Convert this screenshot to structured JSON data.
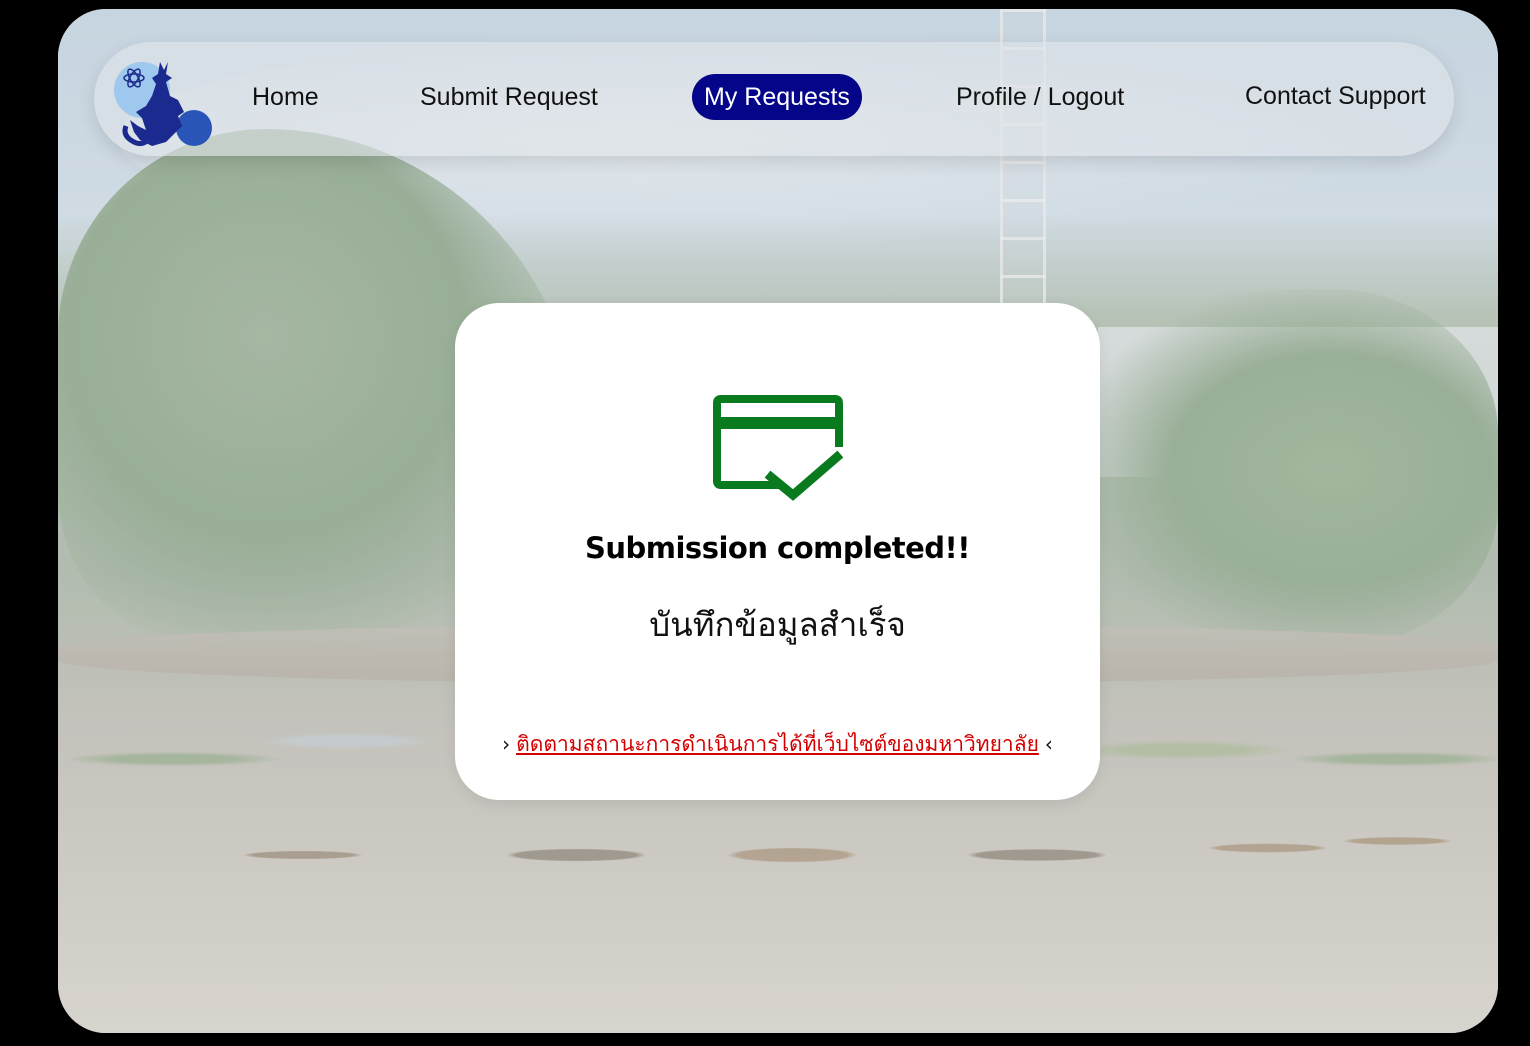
{
  "nav": {
    "items": [
      {
        "label": "Home",
        "active": false
      },
      {
        "label": "Submit Request",
        "active": false
      },
      {
        "label": "My Requests",
        "active": true
      },
      {
        "label": "Profile / Logout",
        "active": false
      },
      {
        "label": "Contact Support",
        "active": false
      }
    ],
    "active_color": "#05058a",
    "logo_icon": "university-emblem-icon"
  },
  "dialog": {
    "icon": "card-check-icon",
    "icon_color": "#0a7a1f",
    "title": "Submission completed!!",
    "subtitle": "บันทึกข้อมูลสำเร็จ",
    "link_prefix": "›",
    "link_text": "ติดตามสถานะการดำเนินการได้ที่เว็บไซต์ของมหาวิทยาลัย",
    "link_suffix": "‹",
    "link_color": "#d40000"
  }
}
